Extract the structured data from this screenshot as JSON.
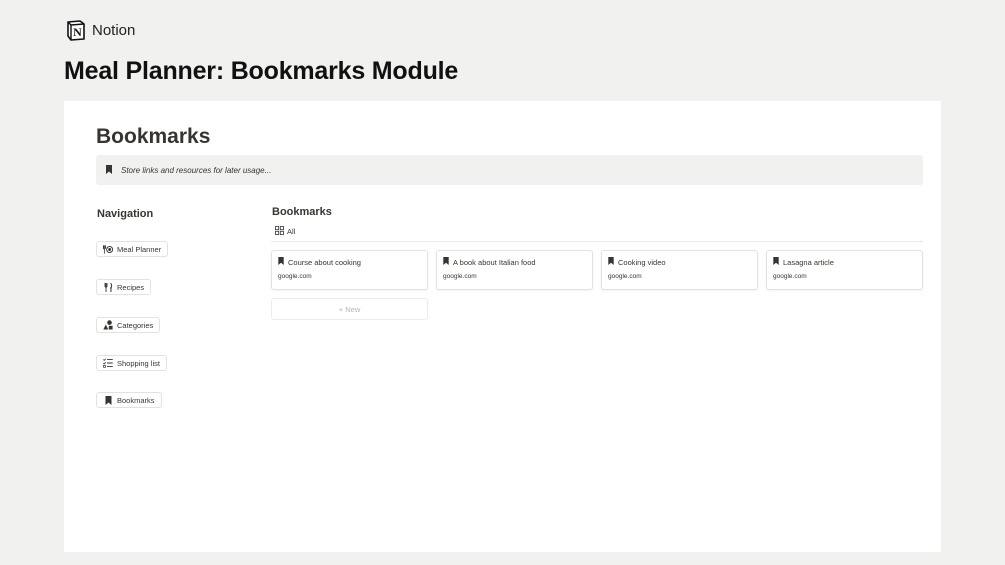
{
  "brand": {
    "name": "Notion",
    "logo_letter": "N"
  },
  "module_title": "Meal Planner: Bookmarks Module",
  "page": {
    "title": "Bookmarks",
    "callout": {
      "icon": "bookmark-icon",
      "text": "Store links and resources for later usage..."
    }
  },
  "navigation": {
    "heading": "Navigation",
    "items": [
      {
        "label": "Meal Planner",
        "icon": "dining-plate-icon"
      },
      {
        "label": "Recipes",
        "icon": "fork-knife-icon"
      },
      {
        "label": "Categories",
        "icon": "shapes-icon"
      },
      {
        "label": "Shopping list",
        "icon": "checklist-icon"
      },
      {
        "label": "Bookmarks",
        "icon": "bookmark-icon"
      }
    ]
  },
  "database": {
    "heading": "Bookmarks",
    "view_tab": {
      "label": "All",
      "icon": "gallery-grid-icon"
    },
    "cards": [
      {
        "title": "Course about cooking",
        "url": "google.com"
      },
      {
        "title": "A book about Italian food",
        "url": "google.com"
      },
      {
        "title": "Cooking video",
        "url": "google.com"
      },
      {
        "title": "Lasagna article",
        "url": "google.com"
      }
    ],
    "new_label": "+ New"
  }
}
